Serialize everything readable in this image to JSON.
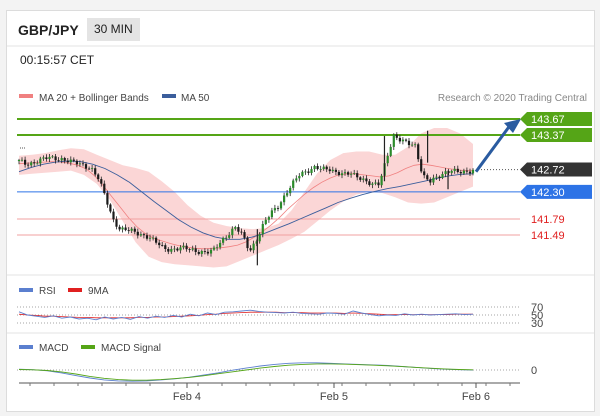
{
  "header": {
    "pair": "GBP/JPY",
    "timeframe": "30 MIN",
    "time": "00:15:57 CET"
  },
  "legend": {
    "bb": "MA 20 + Bollinger Bands",
    "ma50": "MA 50",
    "credit": "Research © 2020 Trading Central",
    "rsi": "RSI",
    "rsi_ma": "9MA",
    "macd": "MACD",
    "macd_signal": "MACD Signal"
  },
  "colors": {
    "bb": "#f08080",
    "ma50": "#3b5e9c",
    "resistance": "#55a517",
    "support_blue": "#2d73e6",
    "support_red": "#e02020",
    "current": "#333333",
    "rsi": "#5b7fcf",
    "rsi_ma": "#e02020",
    "macd": "#5b7fcf",
    "macd_signal": "#55a517"
  },
  "chart_data": [
    {
      "type": "line",
      "x": [
        "Feb 4",
        "Feb 5",
        "Feb 6"
      ],
      "levels": [
        {
          "value": 143.67,
          "label": "143.67",
          "kind": "resistance"
        },
        {
          "value": 143.37,
          "label": "143.37",
          "kind": "resistance"
        },
        {
          "value": 142.72,
          "label": "142.72",
          "kind": "current"
        },
        {
          "value": 142.3,
          "label": "142.30",
          "kind": "support"
        },
        {
          "value": 141.79,
          "label": "141.79",
          "kind": "support-red"
        },
        {
          "value": 141.49,
          "label": "141.49",
          "kind": "support-red"
        }
      ],
      "ylim": [
        140.75,
        144.2
      ],
      "price": [
        142.88,
        142.82,
        142.85,
        142.9,
        142.94,
        142.93,
        142.92,
        142.87,
        142.84,
        142.8,
        142.75,
        142.55,
        142.2,
        141.8,
        141.6,
        141.58,
        141.55,
        141.5,
        141.45,
        141.35,
        141.25,
        141.22,
        141.23,
        141.24,
        141.22,
        141.18,
        141.15,
        141.2,
        141.38,
        141.5,
        141.62,
        141.5,
        141.2,
        141.4,
        141.7,
        141.92,
        142.05,
        142.25,
        142.45,
        142.65,
        142.7,
        142.75,
        142.72,
        142.74,
        142.68,
        142.62,
        142.64,
        142.6,
        142.52,
        142.42,
        142.45,
        142.95,
        143.35,
        143.25,
        143.22,
        143.18,
        142.6,
        142.48,
        142.58,
        142.67,
        142.7,
        142.66,
        142.68,
        142.72
      ],
      "ma20": [
        142.83,
        142.84,
        142.85,
        142.86,
        142.87,
        142.86,
        142.84,
        142.8,
        142.73,
        142.6,
        142.42,
        142.22,
        142.02,
        141.82,
        141.65,
        141.52,
        141.43,
        141.38,
        141.33,
        141.29,
        141.26,
        141.24,
        141.23,
        141.24,
        141.25,
        141.27,
        141.3,
        141.36,
        141.45,
        141.56,
        141.68,
        141.82,
        141.98,
        142.12,
        142.26,
        142.38,
        142.48,
        142.56,
        142.62,
        142.64,
        142.64,
        142.62,
        142.6,
        142.58,
        142.6,
        142.66,
        142.74,
        142.8,
        142.82,
        142.8,
        142.77,
        142.74,
        142.72,
        142.7,
        142.7
      ],
      "ma50": [
        142.68,
        142.76,
        142.82,
        142.86,
        142.88,
        142.87,
        142.82,
        142.74,
        142.62,
        142.48,
        142.3,
        142.12,
        141.95,
        141.78,
        141.64,
        141.53,
        141.45,
        141.41,
        141.41,
        141.45,
        141.52,
        141.61,
        141.7,
        141.8,
        141.9,
        142.0,
        142.1,
        142.18,
        142.25,
        142.31,
        142.36,
        142.4,
        142.45,
        142.5,
        142.55,
        142.6,
        142.63,
        142.64
      ],
      "bb_upper": [
        142.98,
        143.0,
        143.03,
        143.08,
        143.12,
        143.1,
        143.0,
        142.9,
        142.8,
        142.75,
        142.68,
        142.5,
        142.3,
        142.05,
        141.85,
        141.72,
        141.66,
        141.62,
        141.6,
        141.62,
        141.7,
        141.95,
        142.3,
        142.65,
        142.9,
        143.03,
        143.06,
        143.06,
        143.0,
        143.0,
        143.15,
        143.4,
        143.5,
        143.5,
        143.4,
        143.2
      ],
      "bb_lower": [
        142.62,
        142.64,
        142.66,
        142.68,
        142.7,
        142.62,
        142.45,
        142.15,
        141.75,
        141.35,
        141.08,
        140.98,
        140.94,
        140.92,
        140.9,
        140.88,
        140.9,
        141.0,
        141.1,
        141.2,
        141.3,
        141.42,
        141.55,
        141.75,
        141.95,
        142.12,
        142.25,
        142.3,
        142.28,
        142.2,
        142.1,
        142.08,
        142.1,
        142.2,
        142.3,
        142.4
      ]
    },
    {
      "type": "line",
      "series": [
        {
          "name": "RSI"
        },
        {
          "name": "9MA"
        }
      ],
      "levels": [
        {
          "value": 70,
          "label": "70"
        },
        {
          "value": 50,
          "label": "50"
        },
        {
          "value": 30,
          "label": "30"
        }
      ],
      "ylim": [
        0,
        100
      ],
      "rsi": [
        58,
        50,
        47,
        44,
        48,
        42,
        45,
        40,
        42,
        38,
        45,
        40,
        44,
        39,
        46,
        42,
        47,
        44,
        49,
        45,
        52,
        48,
        55,
        51,
        57,
        58,
        60,
        62,
        59,
        57,
        56,
        55,
        57,
        54,
        53,
        52,
        55,
        54,
        52,
        60,
        55,
        51,
        48,
        50,
        49,
        53,
        50,
        52,
        50,
        51,
        52,
        53,
        51,
        52
      ],
      "rsi_ma": [
        52,
        50,
        49,
        47,
        47,
        46,
        45,
        44,
        44,
        43,
        43,
        43,
        43,
        43,
        44,
        44,
        45,
        45,
        46,
        47,
        48,
        49,
        51,
        52,
        54,
        55,
        56,
        57,
        57,
        57,
        57,
        56,
        56,
        56,
        55,
        55,
        55,
        55,
        54,
        55,
        54,
        53,
        52,
        51,
        51,
        51,
        51,
        51,
        51,
        51,
        51,
        52,
        52,
        52
      ]
    },
    {
      "type": "line",
      "series": [
        {
          "name": "MACD"
        },
        {
          "name": "MACD Signal"
        }
      ],
      "levels": [
        {
          "value": 0,
          "label": "0"
        }
      ],
      "ylim": [
        -1,
        1
      ],
      "macd": [
        0.05,
        0.02,
        -0.05,
        -0.18,
        -0.35,
        -0.5,
        -0.62,
        -0.68,
        -0.7,
        -0.68,
        -0.62,
        -0.55,
        -0.45,
        -0.32,
        -0.18,
        -0.02,
        0.12,
        0.25,
        0.35,
        0.42,
        0.45,
        0.45,
        0.42,
        0.38,
        0.35,
        0.32,
        0.28,
        0.22,
        0.16,
        0.1,
        0.05,
        0.02,
        0.0
      ],
      "macd_signal": [
        0.03,
        0.01,
        -0.03,
        -0.12,
        -0.25,
        -0.4,
        -0.52,
        -0.6,
        -0.64,
        -0.64,
        -0.6,
        -0.54,
        -0.46,
        -0.36,
        -0.24,
        -0.12,
        0.0,
        0.12,
        0.22,
        0.3,
        0.35,
        0.38,
        0.38,
        0.36,
        0.33,
        0.3,
        0.26,
        0.21,
        0.16,
        0.11,
        0.07,
        0.03,
        0.01
      ]
    }
  ]
}
